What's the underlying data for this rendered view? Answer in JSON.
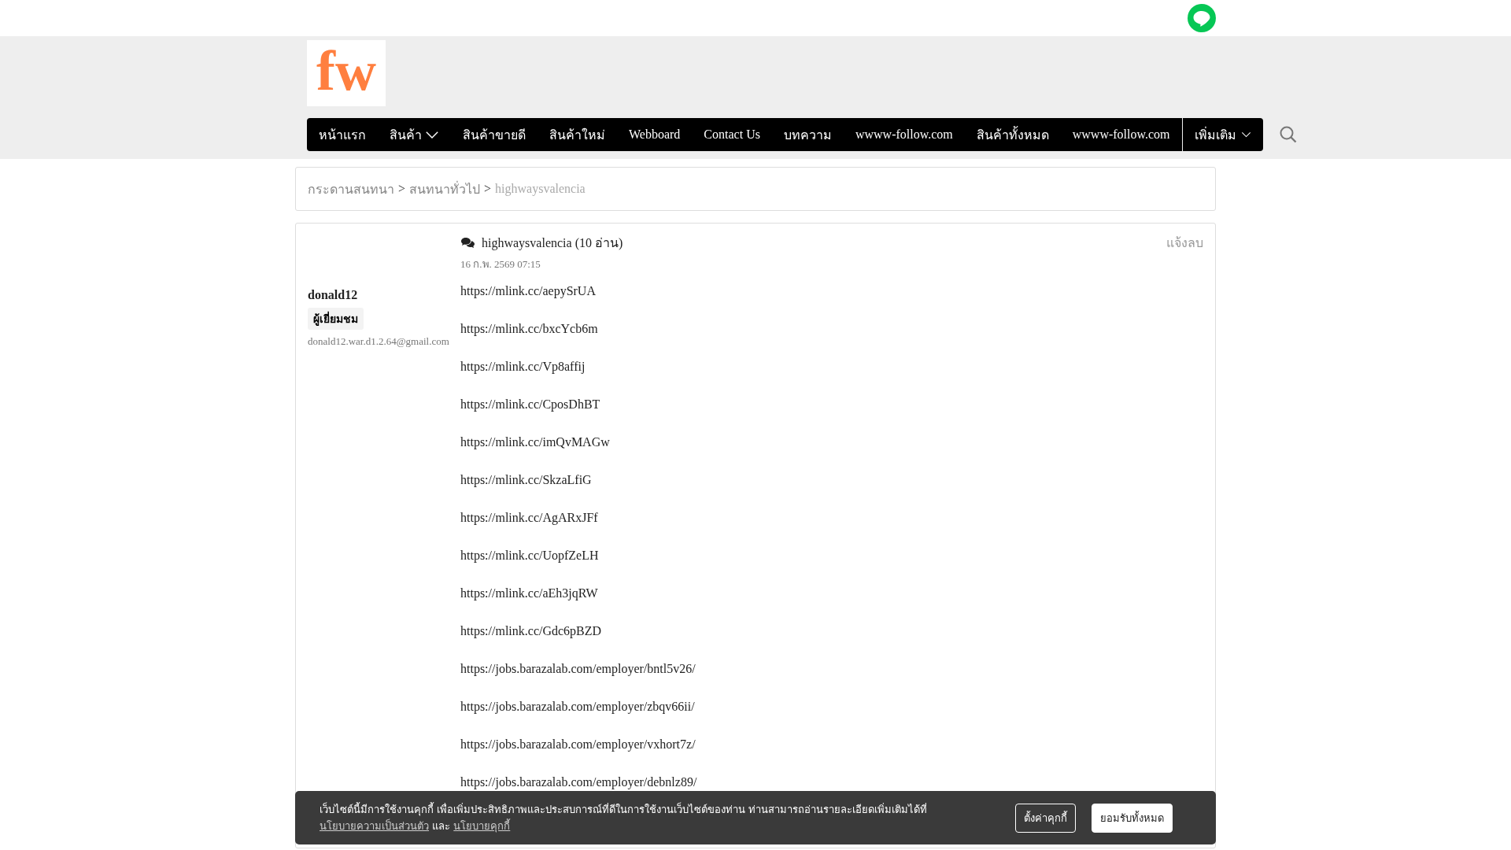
{
  "header": {
    "logo": "fw"
  },
  "nav": {
    "items": [
      {
        "label": "หน้าแรก",
        "dropdown": false
      },
      {
        "label": "สินค้า",
        "dropdown": true
      },
      {
        "label": "สินค้าขายดี",
        "dropdown": false
      },
      {
        "label": "สินค้าใหม่",
        "dropdown": false
      },
      {
        "label": "Webboard",
        "dropdown": false
      },
      {
        "label": "Contact Us",
        "dropdown": false
      },
      {
        "label": "บทความ",
        "dropdown": false
      },
      {
        "label": "wwww-follow.com",
        "dropdown": false
      },
      {
        "label": "สินค้าทั้งหมด",
        "dropdown": false
      },
      {
        "label": "wwww-follow.com",
        "dropdown": false
      }
    ],
    "more": {
      "label": "เพิ่มเติม",
      "dropdown": true
    }
  },
  "breadcrumb": [
    {
      "label": "กระดานสนทนา",
      "current": false
    },
    {
      "label": "สนทนาทั่วไป",
      "current": false
    },
    {
      "label": "highwaysvalencia",
      "current": true
    }
  ],
  "separator": ">",
  "post": {
    "author": "donald12",
    "role": "ผู้เยี่ยมชม",
    "email": "donald12.war.d1.2.64@gmail.com",
    "title": "highwaysvalencia (10 อ่าน)",
    "date": "16 ก.พ. 2569 07:15",
    "report": "แจ้งลบ",
    "links": [
      "https://mlink.cc/aepySrUA",
      "https://mlink.cc/bxcYcb6m",
      "https://mlink.cc/Vp8affij",
      "https://mlink.cc/CposDhBT",
      "https://mlink.cc/imQvMAGw",
      "https://mlink.cc/SkzaLfiG",
      "https://mlink.cc/AgARxJFf",
      "https://mlink.cc/UopfZeLH",
      "https://mlink.cc/aEh3jqRW",
      "https://mlink.cc/Gdc6pBZD",
      "https://jobs.barazalab.com/employer/bntl5v26/",
      "https://jobs.barazalab.com/employer/zbqv66ii/",
      "https://jobs.barazalab.com/employer/vxhort7z/",
      "https://jobs.barazalab.com/employer/debnlz89/"
    ]
  },
  "cookie_bar": {
    "text": "เว็บไซต์นี้มีการใช้งานคุกกี้ เพื่อเพิ่มประสิทธิภาพและประสบการณ์ที่ดีในการใช้งานเว็บไซต์ของท่าน ท่านสามารถอ่านรายละเอียดเพิ่มเติมได้ที่",
    "privacy_link": "นโยบายความเป็นส่วนตัว",
    "conjunction": "และ",
    "cookie_link": "นโยบายคุกกี้",
    "settings_button": "ตั้งค่าคุกกี้",
    "accept_button": "ยอมรับทั้งหมด"
  }
}
